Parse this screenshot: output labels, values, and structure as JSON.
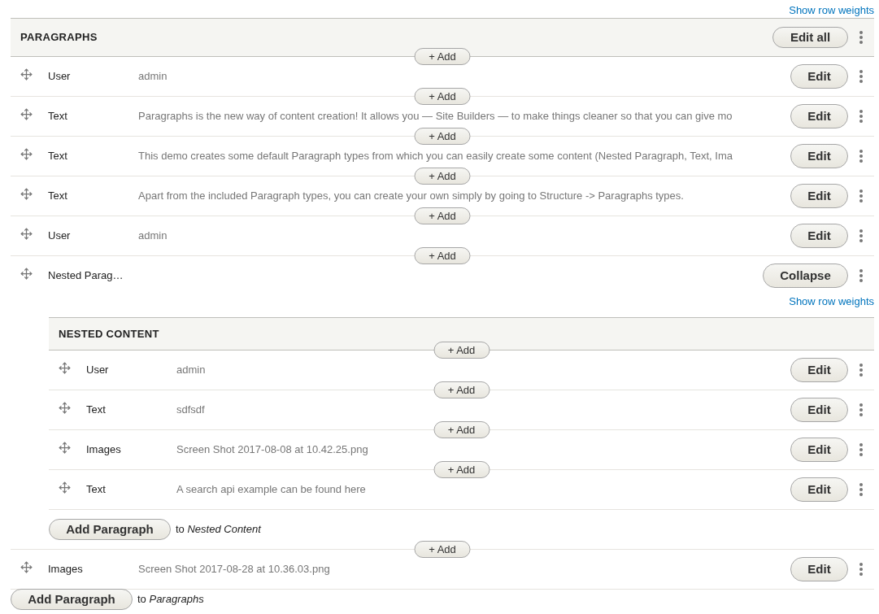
{
  "weights_link": "Show row weights",
  "title": "PARAGRAPHS",
  "header_button": "Edit all",
  "items": [
    {
      "kind": "row",
      "add": "+ Add",
      "type": "User",
      "summary": "admin",
      "button": "Edit"
    },
    {
      "kind": "row",
      "add": "+ Add",
      "type": "Text",
      "summary": "Paragraphs is the new way of content creation! It allows you — Site Builders — to make things cleaner so that you can give mo",
      "button": "Edit"
    },
    {
      "kind": "row",
      "add": "+ Add",
      "type": "Text",
      "summary": "This demo creates some default Paragraph types from which you can easily create some content (Nested Paragraph, Text, Ima",
      "button": "Edit"
    },
    {
      "kind": "row",
      "add": "+ Add",
      "type": "Text",
      "summary": "Apart from the included Paragraph types, you can create your own simply by going to Structure -> Paragraphs types.",
      "button": "Edit"
    },
    {
      "kind": "row",
      "add": "+ Add",
      "type": "User",
      "summary": "admin",
      "button": "Edit"
    },
    {
      "kind": "nested",
      "add": "+ Add",
      "type": "Nested Parag…",
      "button": "Collapse",
      "weights_link": "Show row weights",
      "title": "NESTED CONTENT",
      "items": [
        {
          "add": "+ Add",
          "type": "User",
          "summary": "admin",
          "button": "Edit"
        },
        {
          "add": "+ Add",
          "type": "Text",
          "summary": "sdfsdf",
          "button": "Edit"
        },
        {
          "add": "+ Add",
          "type": "Images",
          "summary": "Screen Shot 2017-08-08 at 10.42.25.png",
          "button": "Edit"
        },
        {
          "add": "+ Add",
          "type": "Text",
          "summary": "A search api example can be found here",
          "button": "Edit"
        }
      ],
      "add_paragraph": {
        "button": "Add Paragraph",
        "text": "to *Nested Content*"
      }
    },
    {
      "kind": "row",
      "add": "+ Add",
      "type": "Images",
      "summary": "Screen Shot 2017-08-28 at 10.36.03.png",
      "button": "Edit"
    }
  ],
  "add_paragraph": {
    "button": "Add Paragraph",
    "text": "to *Paragraphs*"
  }
}
